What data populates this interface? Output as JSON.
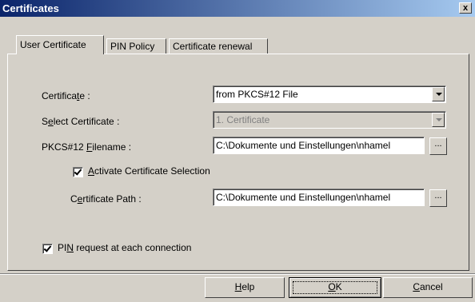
{
  "window": {
    "title": "Certificates",
    "close_label": "x"
  },
  "tabs": [
    {
      "label": "User Certificate",
      "active": true
    },
    {
      "label": "PIN Policy",
      "active": false
    },
    {
      "label": "Certificate renewal",
      "active": false
    }
  ],
  "form": {
    "certificate_label": {
      "pre": "Certifica",
      "ul": "t",
      "post": "e :"
    },
    "certificate_value": "from PKCS#12 File",
    "select_label": {
      "pre": "S",
      "ul": "e",
      "post": "lect Certificate :"
    },
    "select_value": "1. Certificate",
    "pkcs_label": {
      "pre": "PKCS#12 ",
      "ul": "F",
      "post": "ilename :"
    },
    "pkcs_value": "C:\\Dokumente und Einstellungen\\nhamel",
    "browse_label": "...",
    "activate_label": {
      "pre": "",
      "ul": "A",
      "post": "ctivate Certificate Selection"
    },
    "activate_checked": true,
    "path_label": {
      "pre": "C",
      "ul": "e",
      "post": "rtificate Path :"
    },
    "path_value": "C:\\Dokumente und Einstellungen\\nhamel",
    "pin_label": {
      "pre": "PI",
      "ul": "N",
      "post": " request at each connection"
    },
    "pin_checked": true
  },
  "buttons": {
    "help": {
      "ul": "H",
      "post": "elp"
    },
    "ok": {
      "ul": "O",
      "post": "K"
    },
    "cancel": {
      "ul": "C",
      "post": "ancel"
    }
  }
}
